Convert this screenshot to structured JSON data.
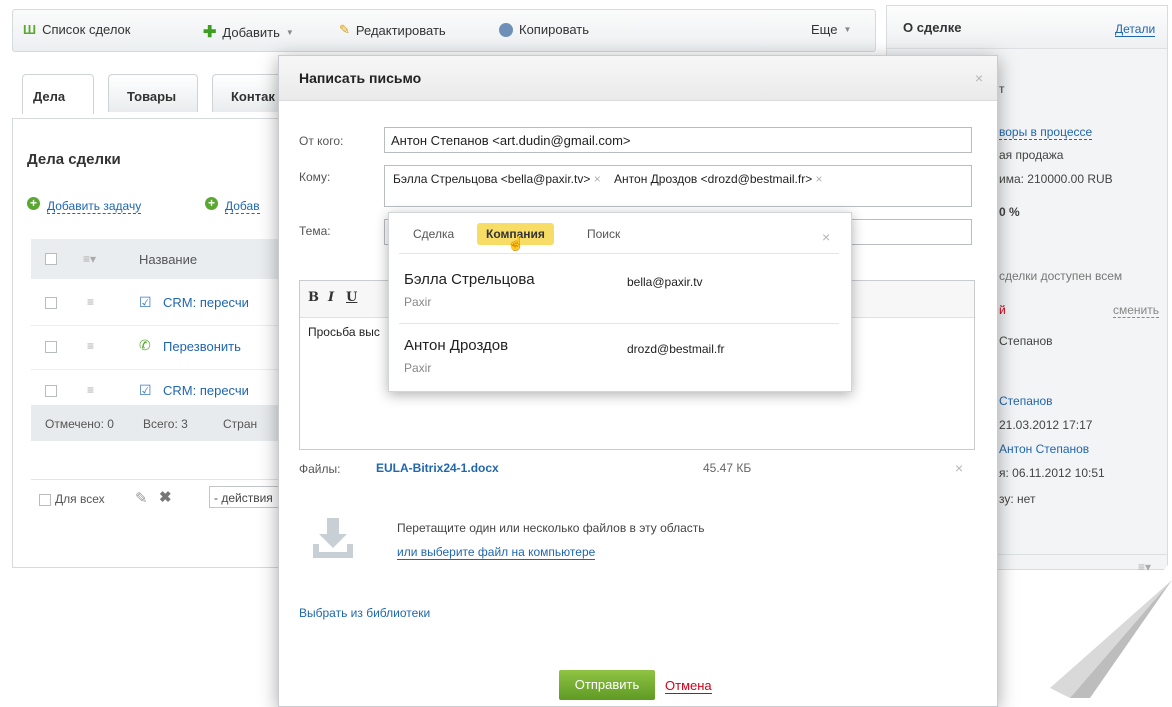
{
  "toolbar": {
    "deals_list": "Список сделок",
    "add": "Добавить",
    "edit": "Редактировать",
    "copy": "Копировать",
    "more": "Еще"
  },
  "tabs": [
    "Дела",
    "Товары",
    "Контак"
  ],
  "activities": {
    "title": "Дела сделки",
    "add_task": "Добавить задачу",
    "add_other": "Добав",
    "col_name": "Название",
    "rows": [
      {
        "text": "CRM: пересчи",
        "icon": "check-icon"
      },
      {
        "text": "Перезвонить",
        "icon": "phone-icon"
      },
      {
        "text": "CRM: пересчи",
        "icon": "check-icon"
      }
    ],
    "marked": "Отмечено: 0",
    "total": "Всего: 3",
    "pages": "Стран",
    "for_all": "Для всех",
    "actions": "- действия"
  },
  "about": {
    "title": "О сделке",
    "details": "Детали",
    "lines": {
      "t": "т",
      "stage": "воры в процессе",
      "type": "ая продажа",
      "sum": "има: 210000.00 RUB",
      "prob": "0 %",
      "access": "сделки доступен всем",
      "resp_short": "й",
      "change": "сменить",
      "resp_name": "Степанов",
      "creator": "Степанов",
      "created": "21.03.2012 17:17",
      "modifier": "Антон Степанов",
      "modified": "я: 06.11.2012 10:51",
      "base": "зу: нет"
    }
  },
  "dialog": {
    "title": "Написать письмо",
    "from_label": "От кого:",
    "from_value": "Антон Степанов <art.dudin@gmail.com>",
    "to_label": "Кому:",
    "recipients": [
      "Бэлла Стрельцова <bella@paxir.tv>",
      "Антон Дроздов <drozd@bestmail.fr>"
    ],
    "subject_label": "Тема:",
    "body_text": "Просьба выс",
    "editor_buttons": [
      "B",
      "I",
      "U"
    ],
    "files_label": "Файлы:",
    "file_name": "EULA-Bitrix24-1.docx",
    "file_size": "45.47 КБ",
    "drop_text": "Перетащите один или несколько файлов в эту область",
    "choose_file": "или выберите файл на компьютере",
    "from_library": "Выбрать из библиотеки",
    "send": "Отправить",
    "cancel": "Отмена"
  },
  "popup": {
    "tabs": [
      "Сделка",
      "Компания",
      "Поиск"
    ],
    "active_tab": "Компания",
    "contacts": [
      {
        "name": "Бэлла Стрельцова",
        "company": "Paxir",
        "email": "bella@paxir.tv"
      },
      {
        "name": "Антон Дроздов",
        "company": "Paxir",
        "email": "drozd@bestmail.fr"
      }
    ]
  },
  "colors": {
    "link": "#2067b0",
    "send_button": "#6fa92f",
    "active_tab": "#f7dd66",
    "cancel_link": "#d0021b"
  }
}
